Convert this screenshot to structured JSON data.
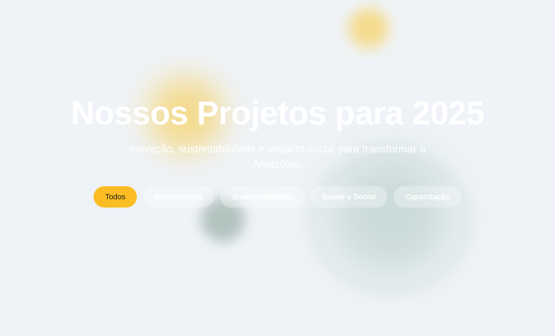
{
  "hero": {
    "title": "Nossos Projetos para 2025",
    "subtitle": "Inovação, sustentabilidade e impacto social para transformar a Amazônia."
  },
  "filters": [
    {
      "label": "Todos",
      "active": true
    },
    {
      "label": "Bioeconomia",
      "active": false
    },
    {
      "label": "Sustentabilidade",
      "active": false
    },
    {
      "label": "Saúde e Social",
      "active": false
    },
    {
      "label": "Capacitação",
      "active": false
    }
  ],
  "colors": {
    "background": "#eff3f7",
    "accent": "#fbbd23",
    "text_on_hero": "#ffffff"
  }
}
